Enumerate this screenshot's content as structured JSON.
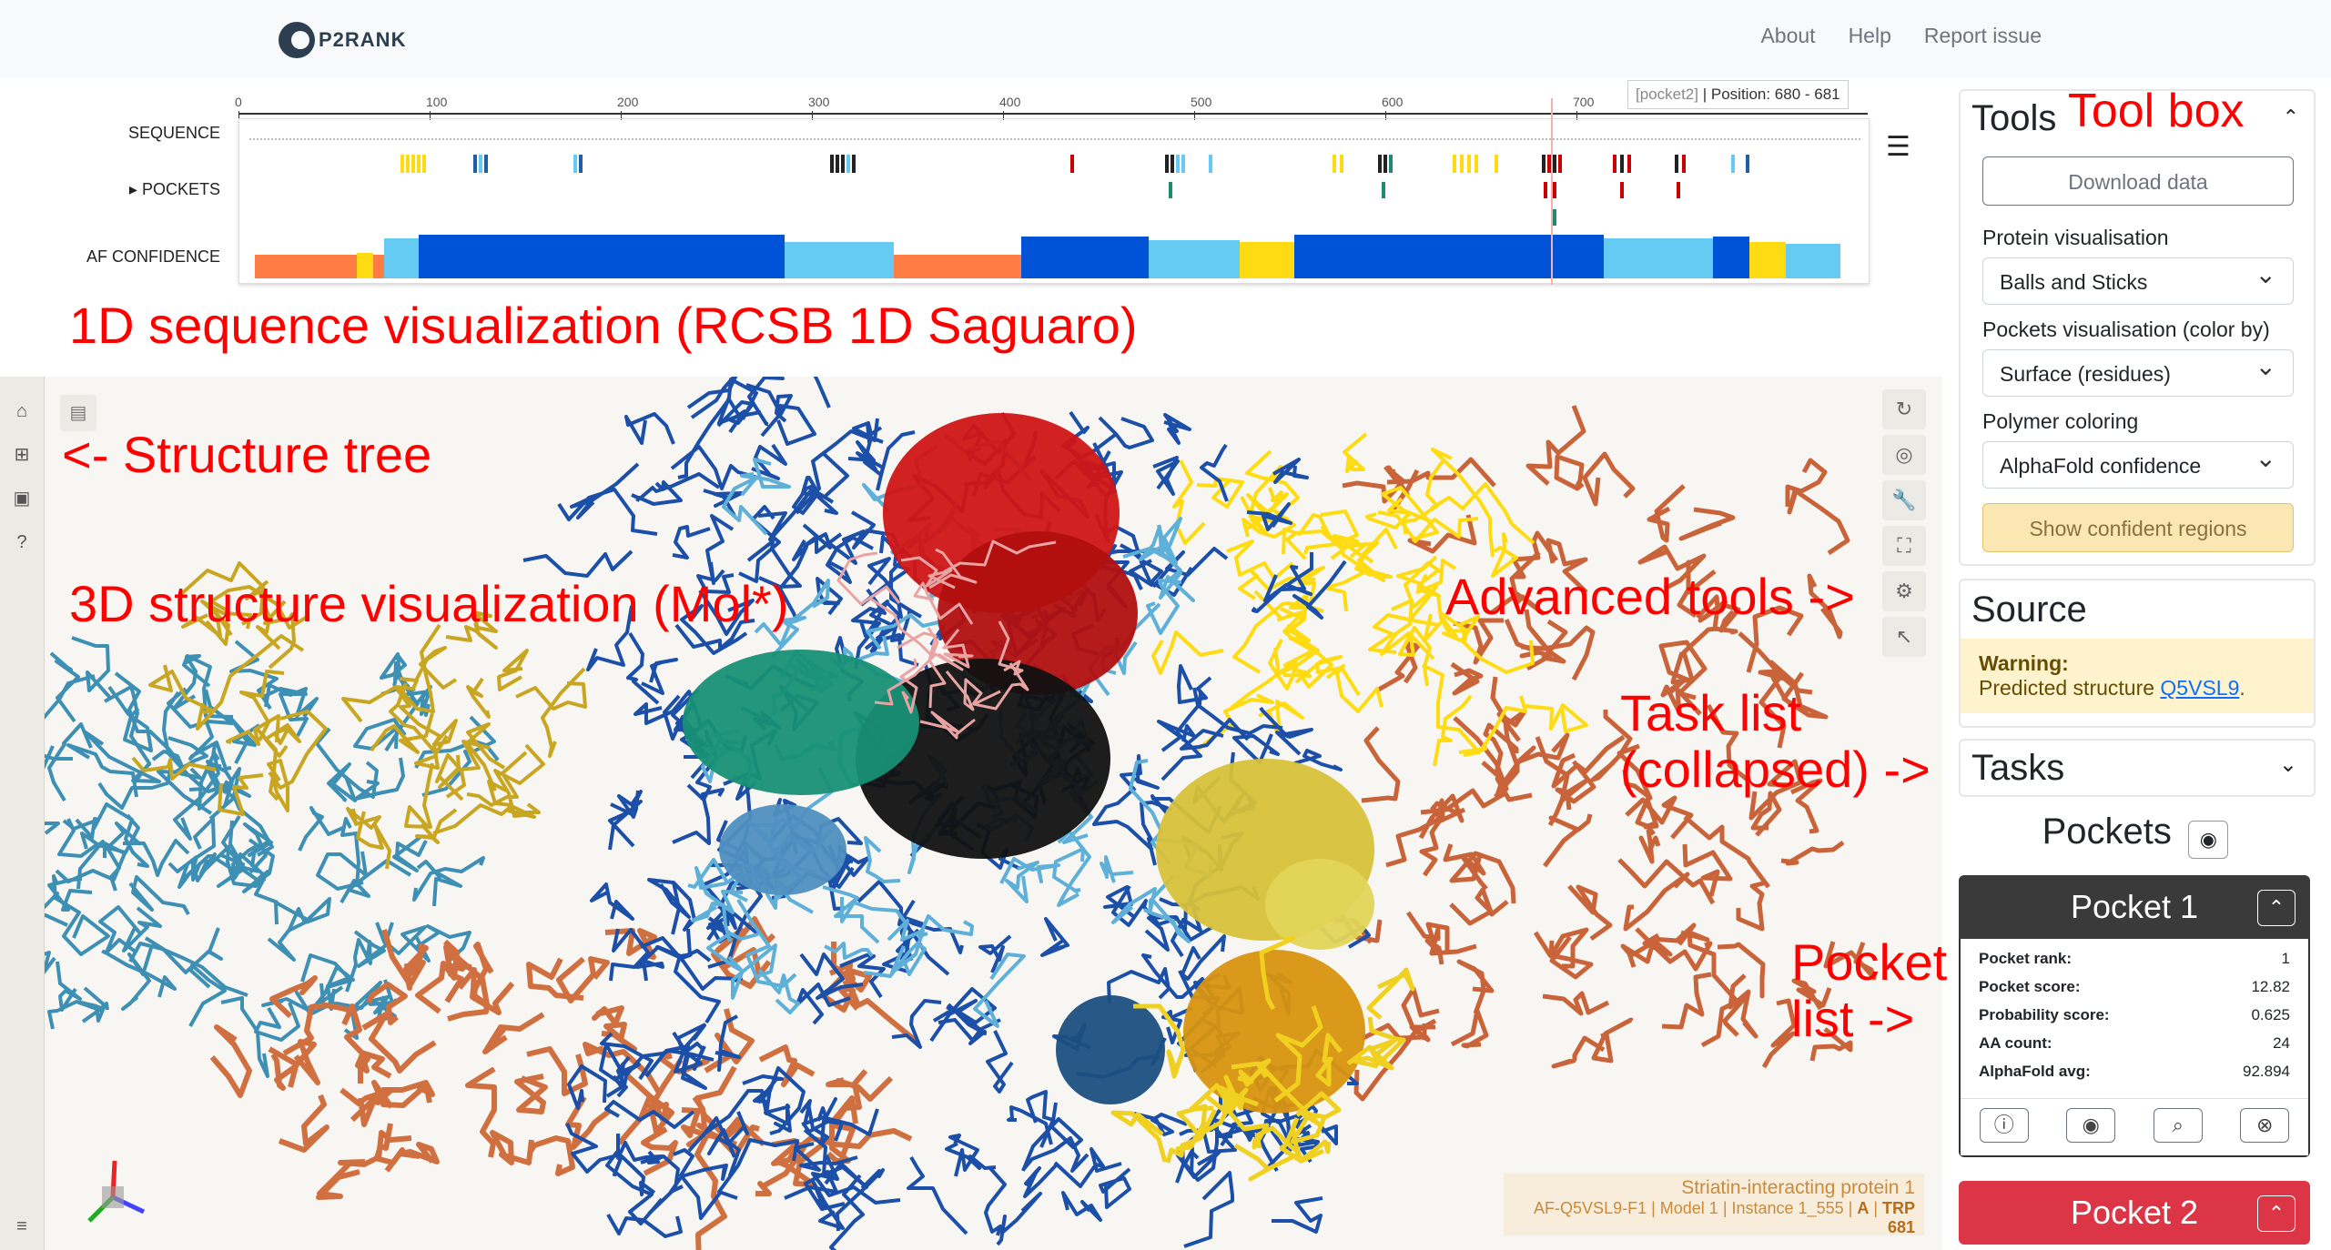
{
  "header": {
    "logo_text": "P2RANK",
    "nav": [
      "About",
      "Help",
      "Report issue"
    ]
  },
  "sequence_viewer": {
    "axis_ticks": [
      "0",
      "100",
      "200",
      "300",
      "400",
      "500",
      "600",
      "700"
    ],
    "rows": {
      "sequence": "SEQUENCE",
      "pockets": "POCKETS",
      "af_confidence": "AF CONFIDENCE"
    },
    "tooltip": {
      "pocket": "[pocket2]",
      "position": "| Position: 680 - 681"
    }
  },
  "viewer_3d": {
    "structure_title": "Striatin-interacting protein 1",
    "structure_path": [
      "AF-Q5VSL9-F1",
      "Model 1",
      "Instance 1_555"
    ],
    "chain": "A",
    "residue": "TRP 681"
  },
  "tools": {
    "title": "Tools",
    "download_label": "Download data",
    "protein_vis_label": "Protein visualisation",
    "protein_vis_value": "Balls and Sticks",
    "pocket_vis_label": "Pockets visualisation (color by)",
    "pocket_vis_value": "Surface (residues)",
    "polymer_coloring_label": "Polymer coloring",
    "polymer_coloring_value": "AlphaFold confidence",
    "show_confident_label": "Show confident regions"
  },
  "source": {
    "title": "Source",
    "warning_title": "Warning:",
    "warning_text": "Predicted structure ",
    "warning_link": "Q5VSL9",
    "warning_end": "."
  },
  "tasks": {
    "title": "Tasks"
  },
  "pockets": {
    "title": "Pockets",
    "items": [
      {
        "name": "Pocket 1",
        "color": "#3a3a3a",
        "rank_label": "Pocket rank:",
        "rank": "1",
        "score_label": "Pocket score:",
        "score": "12.82",
        "prob_label": "Probability score:",
        "prob": "0.625",
        "aa_label": "AA count:",
        "aa": "24",
        "af_label": "AlphaFold avg:",
        "af": "92.894"
      },
      {
        "name": "Pocket 2",
        "color": "#dc3545"
      }
    ]
  },
  "annotations": {
    "tool_box": "Tool box",
    "seq_viz": "1D sequence visualization (RCSB 1D Saguaro)",
    "structure_tree": "<- Structure tree",
    "structure_viz": "3D structure visualization (Mol*)",
    "advanced_tools": "Advanced tools ->",
    "task_list_1": "Task list",
    "task_list_2": "(collapsed) ->",
    "pocket_list_1": "Pocket",
    "pocket_list_2": "list ->"
  },
  "colors": {
    "af_very_high": "#0053d6",
    "af_confident": "#65cbf3",
    "af_low": "#ffdb13",
    "af_very_low": "#ff7d45",
    "annotation": "#ff0000"
  }
}
